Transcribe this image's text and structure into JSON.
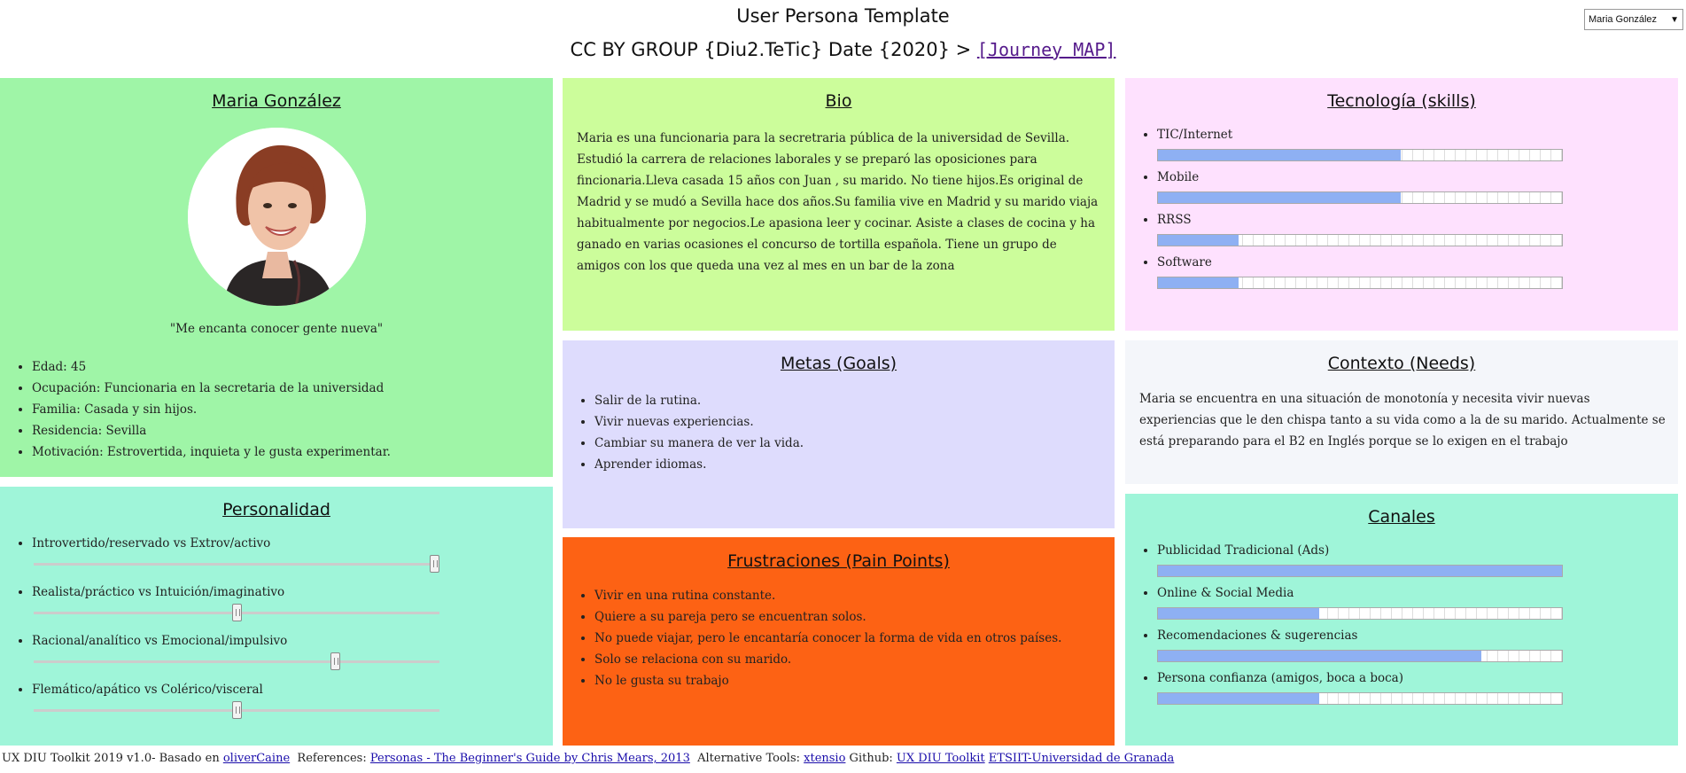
{
  "header": {
    "title": "User Persona Template",
    "subtitle_prefix": "CC BY GROUP {Diu2.TeTic} Date {2020} > ",
    "journey_link": "[Journey MAP]"
  },
  "persona_select": {
    "selected": "Maria González",
    "arrow": "▼"
  },
  "persona": {
    "name": "Maria González",
    "quote": "\"Me encanta conocer gente nueva\"",
    "facts": [
      "Edad: 45",
      "Ocupación: Funcionaria en la secretaria de la universidad",
      "Familia: Casada y sin hijos.",
      "Residencia: Sevilla",
      "Motivación: Estrovertida, inquieta y le gusta experimentar."
    ]
  },
  "bio": {
    "title": "Bio",
    "text": "Maria es una funcionaria para la secretraria pública de la universidad de Sevilla. Estudió la carrera de relaciones laborales y se preparó las oposiciones para fincionaria.Lleva casada 15 años con Juan , su marido. No tiene hijos.Es original de Madrid y se mudó a Sevilla hace dos años.Su familia vive en Madrid y su marido viaja habitualmente por negocios.Le apasiona leer y cocinar. Asiste a clases de cocina y ha ganado en varias ocasiones el concurso de tortilla española. Tiene un grupo de amigos con los que queda una vez al mes en un bar de la zona"
  },
  "tech": {
    "title": "Tecnología (skills)",
    "items": [
      {
        "label": "TIC/Internet",
        "level": 0.6
      },
      {
        "label": "Mobile",
        "level": 0.6
      },
      {
        "label": "RRSS",
        "level": 0.2
      },
      {
        "label": "Software",
        "level": 0.2
      }
    ]
  },
  "goals": {
    "title": "Metas (Goals)",
    "items": [
      "Salir de la rutina.",
      "Vivir nuevas experiencias.",
      "Cambiar su manera de ver la vida.",
      "Aprender idiomas."
    ]
  },
  "context": {
    "title": "Contexto (Needs)",
    "text": "Maria se encuentra en una situación de monotonía y necesita vivir nuevas experiencias que le den chispa tanto a su vida como a la de su marido. Actualmente se está preparando para el B2 en Inglés porque se lo exigen en el trabajo"
  },
  "personality": {
    "title": "Personalidad",
    "items": [
      {
        "label": "Introvertido/reservado vs Extrov/activo",
        "value": 1.0
      },
      {
        "label": "Realista/práctico vs Intuición/imaginativo",
        "value": 0.5
      },
      {
        "label": "Racional/analítico vs Emocional/impulsivo",
        "value": 0.75
      },
      {
        "label": "Flemático/apático vs Colérico/visceral",
        "value": 0.5
      }
    ]
  },
  "frustrations": {
    "title": "Frustraciones (Pain Points)",
    "items": [
      "Vivir en una rutina constante.",
      "Quiere a su pareja pero se encuentran solos.",
      "No puede viajar, pero le encantaría conocer la forma de vida en otros países.",
      "Solo se relaciona con su marido.",
      "No le gusta su trabajo"
    ]
  },
  "channels": {
    "title": "Canales",
    "items": [
      {
        "label": "Publicidad Tradicional (Ads)",
        "level": 1.0
      },
      {
        "label": "Online & Social Media",
        "level": 0.4
      },
      {
        "label": "Recomendaciones & sugerencias",
        "level": 0.8
      },
      {
        "label": "Persona confianza (amigos, boca a boca)",
        "level": 0.4
      }
    ]
  },
  "footer": {
    "toolkit": "UX DIU Toolkit 2019 v1.0- Basado en ",
    "olivercaine": "oliverCaine",
    "references_label": "  References: ",
    "personas_link": "Personas - The Beginner's Guide by Chris Mears, 2013",
    "alt_tools_label": "  Alternative Tools: ",
    "xtensio": "xtensio",
    "github_label": " Github: ",
    "ux_link": "UX DIU Toolkit",
    "etsiit_link": "ETSIIT-Universidad de Granada"
  },
  "colors": {
    "persona_bg": "#9ff5a7",
    "bio_bg": "#ccfd9b",
    "tech_bg": "#fee1fe",
    "goals_bg": "#dedcfd",
    "context_bg": "#f4f6fa",
    "frustrations_bg": "#fd6214",
    "personality_bg": "#9ff5d9",
    "bar_fill": "#8eb0f3"
  }
}
